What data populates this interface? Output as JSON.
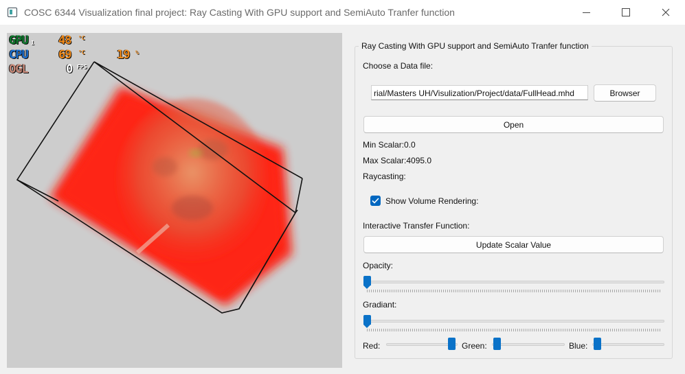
{
  "window": {
    "title": "COSC 6344 Visualization final project: Ray Casting With GPU support and SemiAuto Tranfer function"
  },
  "overlay": {
    "gpu_label": "GPU",
    "gpu_sub": "1",
    "gpu_value": "48",
    "gpu_unit": "°C",
    "cpu_label": "CPU",
    "cpu_value": "69",
    "cpu_unit": "°C",
    "cpu_load": "19",
    "cpu_load_unit": "%",
    "ogl_label": "OGL",
    "ogl_value": "0",
    "ogl_unit": "FPS",
    "colors": {
      "gpu": "#0f7a2e",
      "cpu": "#1b6fd0",
      "ogl": "#c98a7a",
      "value": "#f08a1a"
    }
  },
  "panel": {
    "group_title": "Ray Casting With GPU support and SemiAuto Tranfer function",
    "choose_label": "Choose a Data file:",
    "file_path": "rial/Masters UH/Visulization/Project/data/FullHead.mhd",
    "browser_button": "Browser",
    "open_button": "Open",
    "min_scalar": "Min Scalar:0.0",
    "max_scalar": "Max Scalar:4095.0",
    "raycasting_label": "Raycasting:",
    "show_volume_label": "Show Volume Rendering:",
    "show_volume_checked": true,
    "itf_label": "Interactive Transfer Function:",
    "update_button": "Update Scalar Value",
    "opacity_label": "Opacity:",
    "opacity_value": 0,
    "gradient_label": "Gradiant:",
    "gradient_value": 0,
    "red_label": "Red:",
    "red_value": 0.95,
    "green_label": "Green:",
    "green_value": 0.05,
    "blue_label": "Blue:",
    "blue_value": 0.05,
    "accent_color": "#0067c0"
  }
}
